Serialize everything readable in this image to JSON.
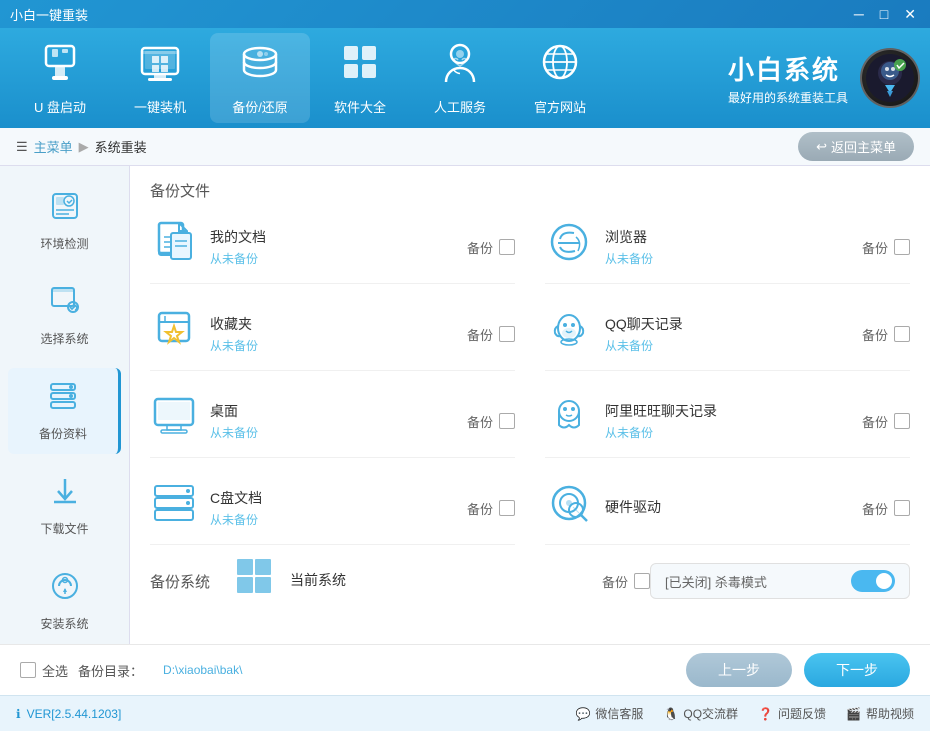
{
  "app": {
    "title": "小白一键重装",
    "min_btn": "─",
    "max_btn": "□",
    "close_btn": "✕"
  },
  "nav": {
    "items": [
      {
        "id": "usb",
        "label": "U 盘启动",
        "icon": "💾"
      },
      {
        "id": "reinstall",
        "label": "一键装机",
        "icon": "🖥"
      },
      {
        "id": "backup",
        "label": "备份/还原",
        "icon": "🗄"
      },
      {
        "id": "software",
        "label": "软件大全",
        "icon": "⊞"
      },
      {
        "id": "service",
        "label": "人工服务",
        "icon": "👤"
      },
      {
        "id": "website",
        "label": "官方网站",
        "icon": "🌐"
      }
    ]
  },
  "brand": {
    "title": "小白系统",
    "subtitle": "最好用的系统重装工具"
  },
  "breadcrumb": {
    "home": "主菜单",
    "current": "系统重装",
    "back_btn": "返回主菜单"
  },
  "sidebar": {
    "items": [
      {
        "id": "env",
        "label": "环境检测",
        "icon": "⚙"
      },
      {
        "id": "select",
        "label": "选择系统",
        "icon": "🖱"
      },
      {
        "id": "data",
        "label": "备份资料",
        "icon": "🗃",
        "active": true
      },
      {
        "id": "download",
        "label": "下载文件",
        "icon": "⬇"
      },
      {
        "id": "install",
        "label": "安装系统",
        "icon": "🔧"
      }
    ]
  },
  "backup_files": {
    "section_label": "备份文件",
    "items_left": [
      {
        "name": "我的文档",
        "status": "从未备份",
        "backup_label": "备份"
      },
      {
        "name": "收藏夹",
        "status": "从未备份",
        "backup_label": "备份"
      },
      {
        "name": "桌面",
        "status": "从未备份",
        "backup_label": "备份"
      },
      {
        "name": "C盘文档",
        "status": "从未备份",
        "backup_label": "备份"
      }
    ],
    "items_right": [
      {
        "name": "浏览器",
        "status": "从未备份",
        "backup_label": "备份"
      },
      {
        "name": "QQ聊天记录",
        "status": "从未备份",
        "backup_label": "备份"
      },
      {
        "name": "阿里旺旺聊天记录",
        "status": "从未备份",
        "backup_label": "备份"
      },
      {
        "name": "硬件驱动",
        "backup_label": "备份"
      }
    ]
  },
  "backup_system": {
    "section_label": "备份系统",
    "item_name": "当前系统",
    "backup_label": "备份",
    "antivirus_label": "[已关闭] 杀毒模式"
  },
  "footer": {
    "select_all": "全选",
    "backup_dir_label": "备份目录：",
    "backup_dir_path": "D:\\xiaobai\\bak\\",
    "prev_btn": "上一步",
    "next_btn": "下一步"
  },
  "status_bar": {
    "version": "VER[2.5.44.1203]",
    "items": [
      {
        "icon": "💬",
        "label": "微信客服"
      },
      {
        "icon": "🐧",
        "label": "QQ交流群"
      },
      {
        "icon": "❓",
        "label": "问题反馈"
      },
      {
        "icon": "🎬",
        "label": "帮助视频"
      }
    ]
  }
}
